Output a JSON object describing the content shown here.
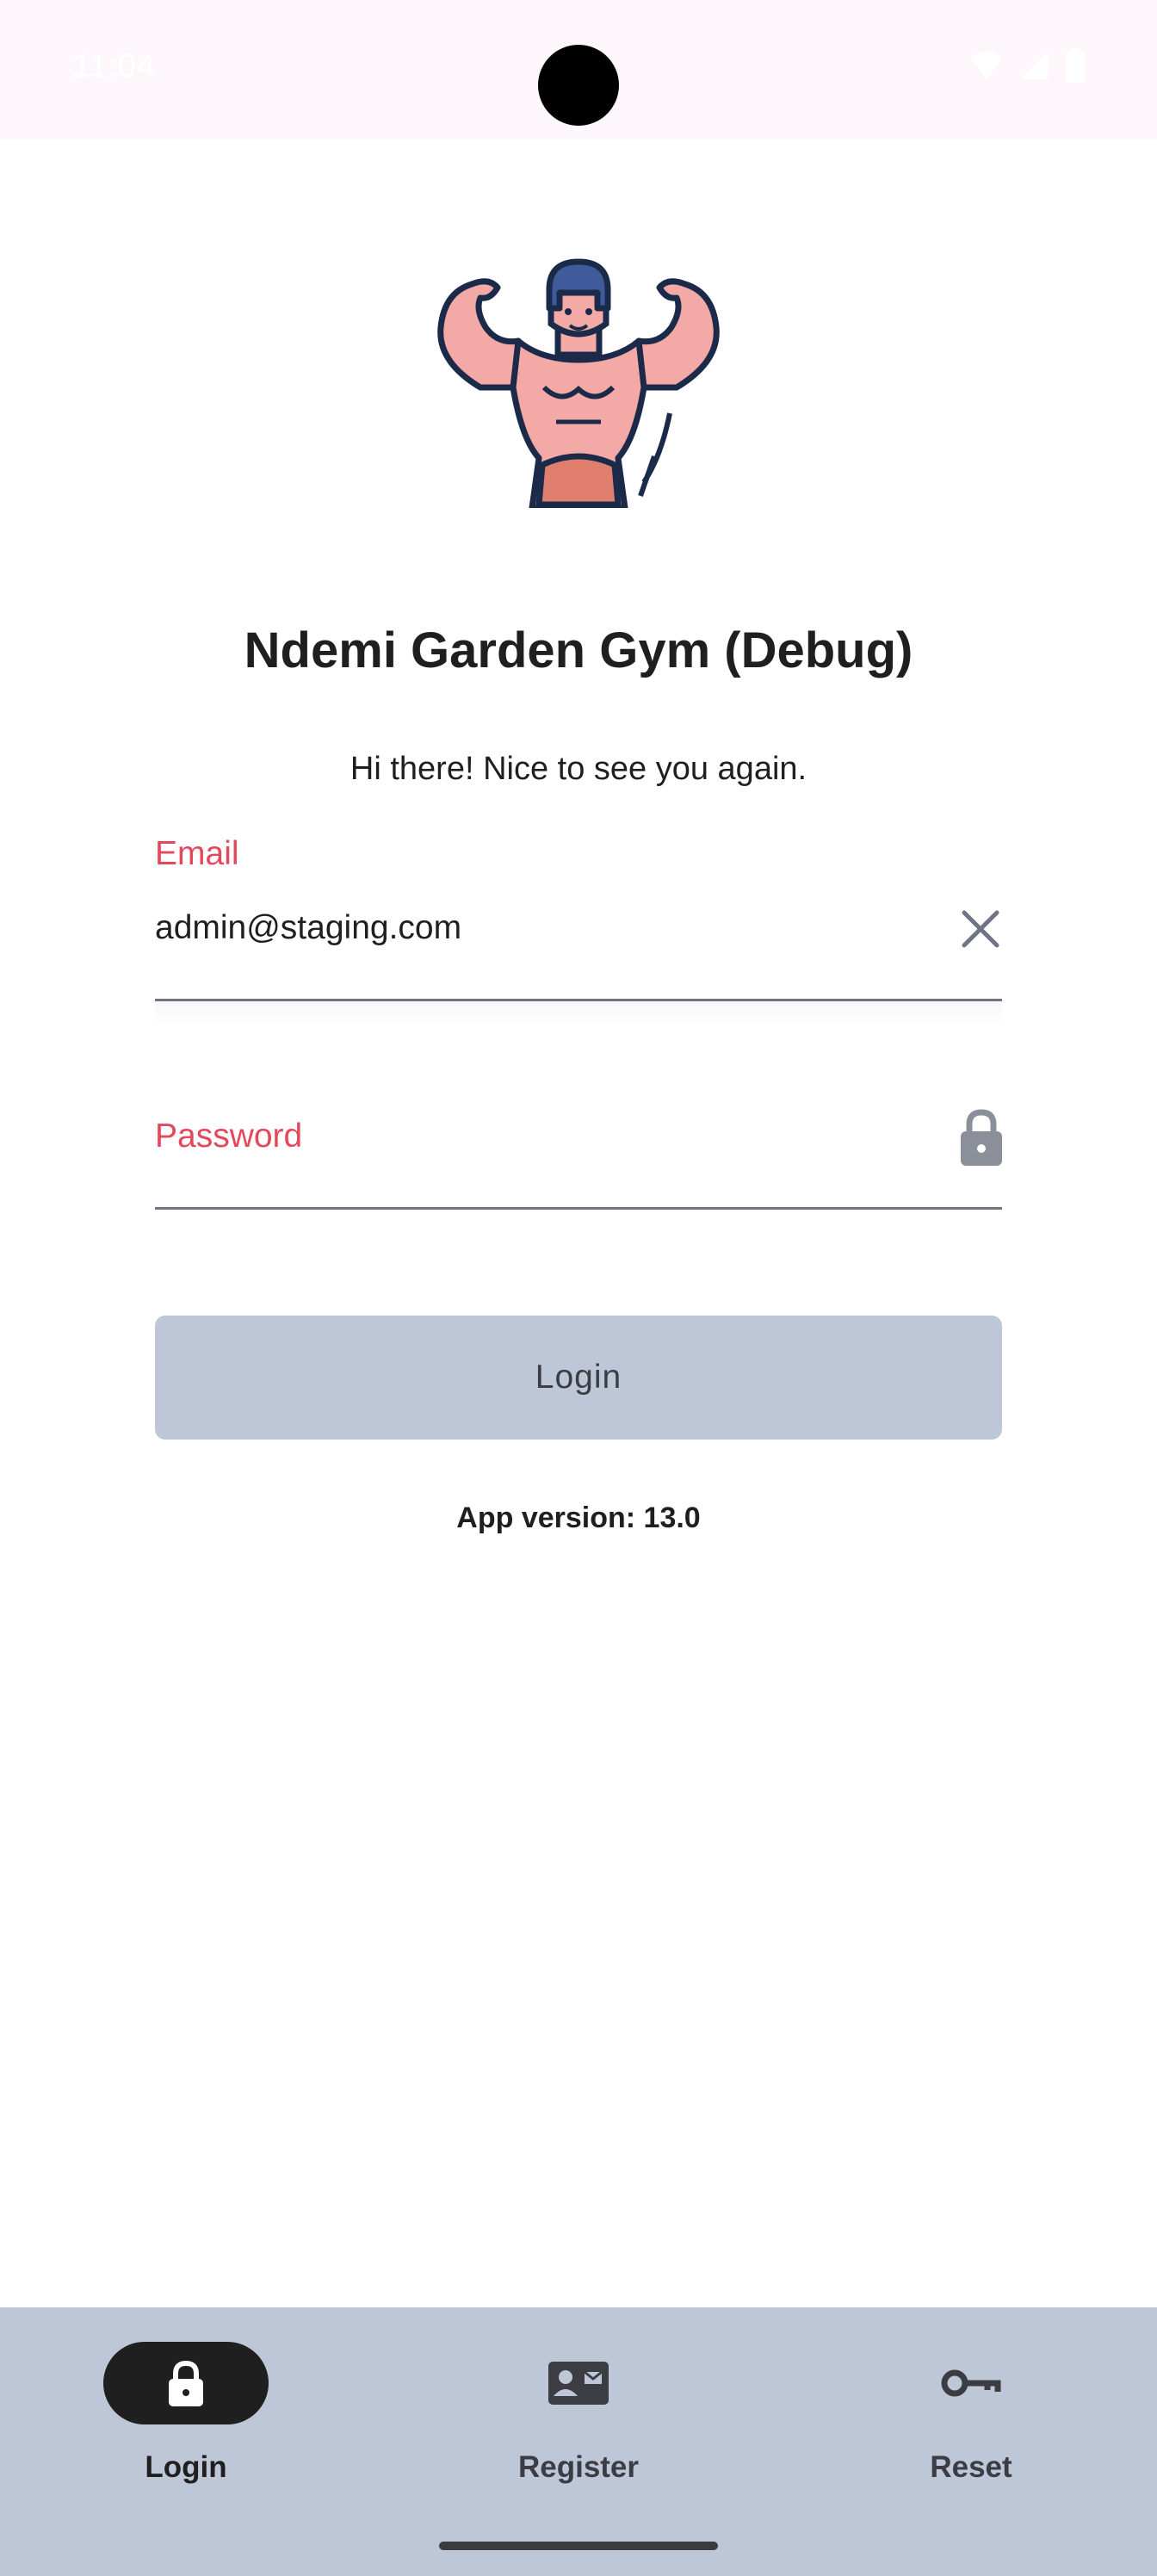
{
  "status_bar": {
    "time": "11:04"
  },
  "app": {
    "title": "Ndemi Garden Gym (Debug)",
    "greeting": "Hi there! Nice to see you again.",
    "version_text": "App version: 13.0"
  },
  "form": {
    "email_label": "Email",
    "email_value": "admin@staging.com",
    "password_label": "Password",
    "password_value": "",
    "login_label": "Login"
  },
  "bottom_nav": {
    "items": [
      {
        "label": "Login",
        "icon": "lock-icon",
        "active": true
      },
      {
        "label": "Register",
        "icon": "contact-card-icon",
        "active": false
      },
      {
        "label": "Reset",
        "icon": "key-icon",
        "active": false
      }
    ]
  },
  "colors": {
    "accent_label": "#e5485d",
    "nav_background": "#bec7d8",
    "active_pill": "#1f1f1f",
    "status_bar_bg": "#fdf7fc"
  }
}
